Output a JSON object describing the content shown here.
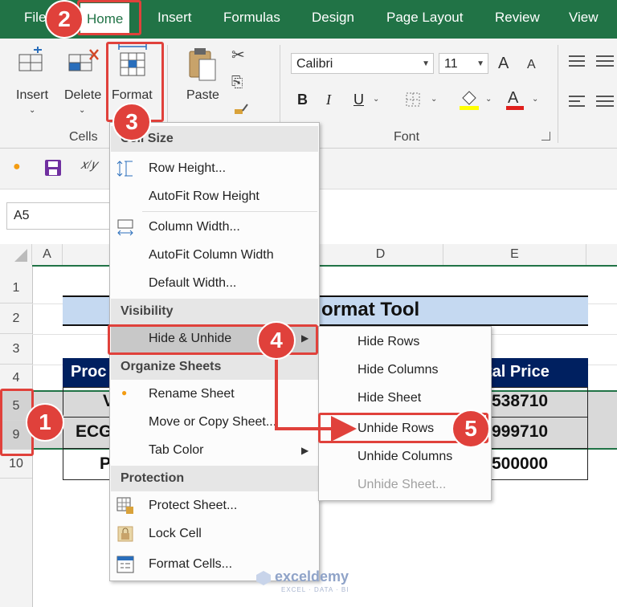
{
  "tabs": [
    {
      "label": "File"
    },
    {
      "label": "Home"
    },
    {
      "label": "Insert"
    },
    {
      "label": "Formulas"
    },
    {
      "label": "Design"
    },
    {
      "label": "Page Layout"
    },
    {
      "label": "Review"
    },
    {
      "label": "View"
    }
  ],
  "ribbon": {
    "insert": "Insert",
    "delete": "Delete",
    "format": "Format",
    "cells_group": "Cells",
    "paste": "Paste",
    "font_name": "Calibri",
    "font_size": "11",
    "font_group": "Font",
    "bold": "B",
    "italic": "I",
    "underline": "U",
    "grow": "A",
    "shrink": "A"
  },
  "name_box": "A5",
  "columns": [
    "A",
    "D",
    "E"
  ],
  "rows": [
    "1",
    "2",
    "3",
    "4",
    "5",
    "9",
    "10"
  ],
  "sheet": {
    "title": "ormat Tool",
    "header_left": "Proc",
    "header_right": "tal Price",
    "row5_left": "V",
    "row5_right": "538710",
    "row9_left": "ECG",
    "row9_right": "999710",
    "row10_left": "P",
    "row10_right": "500000"
  },
  "menu": {
    "cell_size": "Cell Size",
    "row_height": "Row Height...",
    "autofit_row": "AutoFit Row Height",
    "column_width": "Column Width...",
    "autofit_col": "AutoFit Column Width",
    "default_width": "Default Width...",
    "visibility": "Visibility",
    "hide_unhide": "Hide & Unhide",
    "organize": "Organize Sheets",
    "rename": "Rename Sheet",
    "move_copy": "Move or Copy Sheet...",
    "tab_color": "Tab Color",
    "protection": "Protection",
    "protect": "Protect Sheet...",
    "lock": "Lock Cell",
    "format_cells": "Format Cells..."
  },
  "submenu": {
    "hide_rows": "Hide Rows",
    "hide_columns": "Hide Columns",
    "hide_sheet": "Hide Sheet",
    "unhide_rows": "Unhide Rows",
    "unhide_columns": "Unhide Columns",
    "unhide_sheet": "Unhide Sheet..."
  },
  "steps": [
    "1",
    "2",
    "3",
    "4",
    "5"
  ],
  "watermark": "exceldemy",
  "watermark_sub": "EXCEL · DATA · BI",
  "colors": {
    "accent": "#217346",
    "annotation": "#e0413b",
    "header_fill": "#002060",
    "title_fill": "#c5d9f1"
  }
}
